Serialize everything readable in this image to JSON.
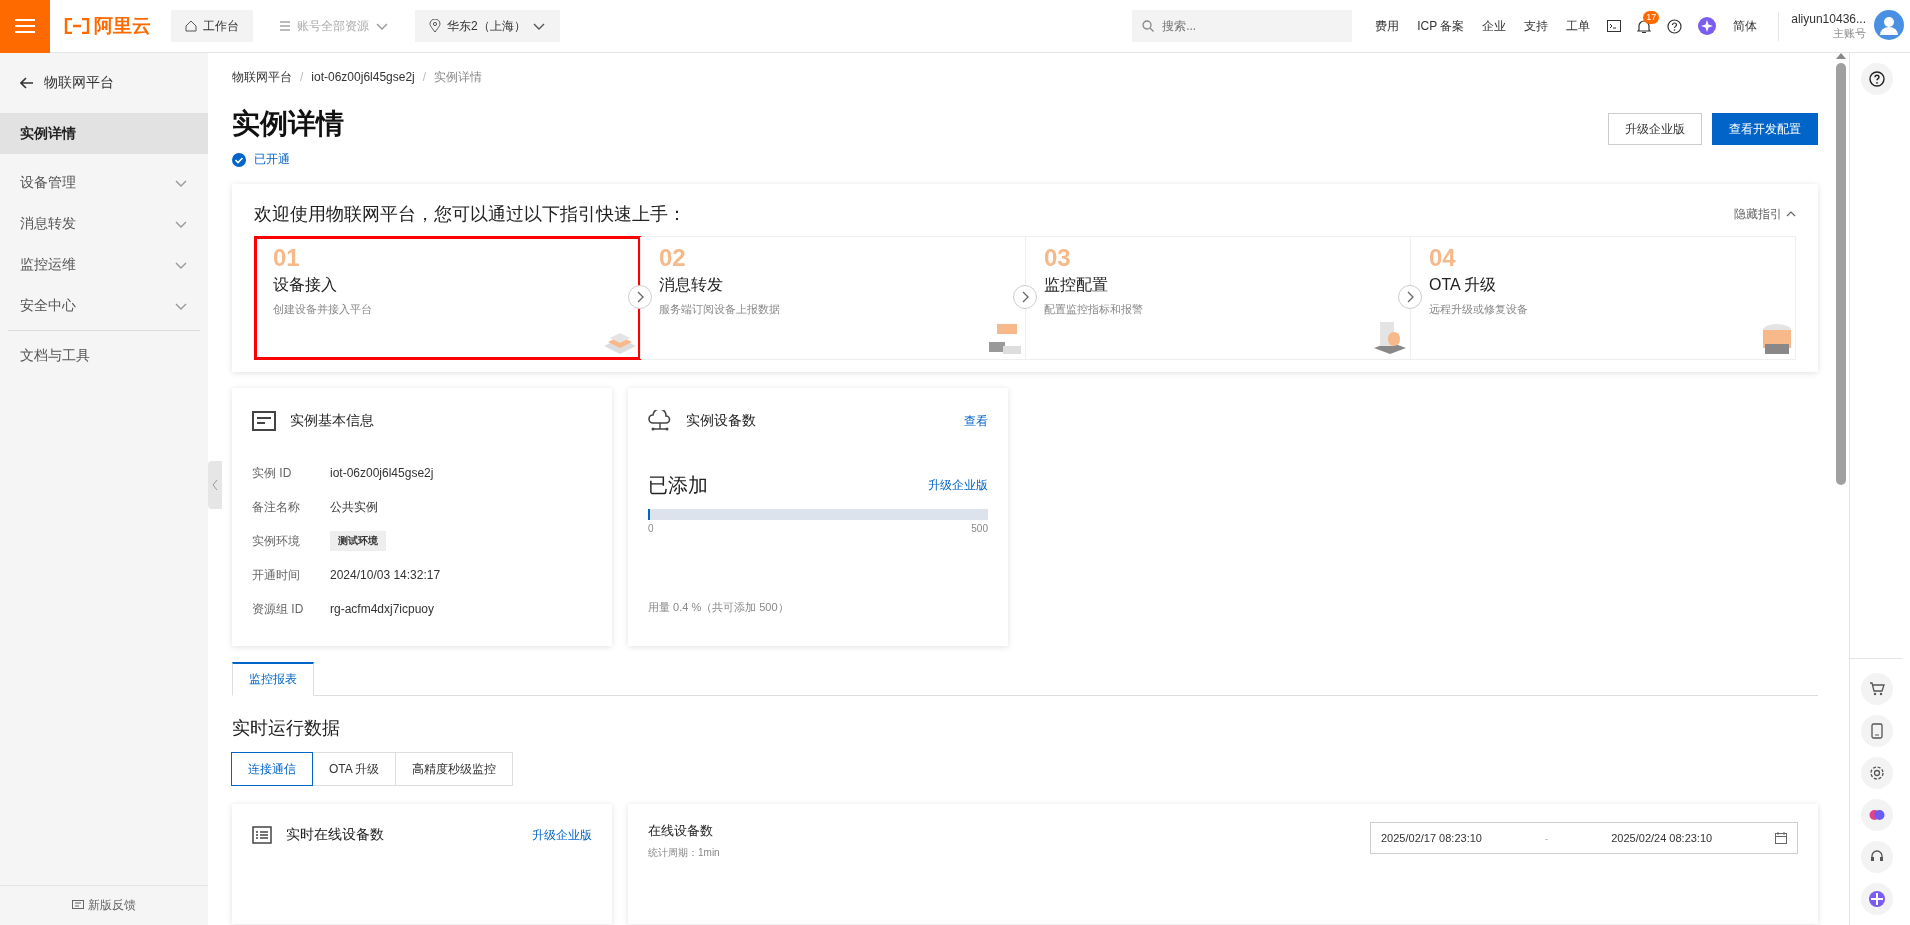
{
  "topbar": {
    "logo": "阿里云",
    "workbench": "工作台",
    "resources": {
      "label": "账号全部资源",
      "disabled": true
    },
    "region": "华东2（上海）",
    "search": {
      "placeholder": "搜索..."
    },
    "links": [
      "费用",
      "ICP 备案",
      "企业",
      "支持",
      "工单"
    ],
    "notifications": "17",
    "language": "简体",
    "account": {
      "name": "aliyun10436...",
      "role": "主账号"
    }
  },
  "sidebar": {
    "back": "物联网平台",
    "items": [
      {
        "label": "实例详情",
        "selected": true,
        "expandable": false
      },
      {
        "label": "设备管理",
        "selected": false,
        "expandable": true
      },
      {
        "label": "消息转发",
        "selected": false,
        "expandable": true
      },
      {
        "label": "监控运维",
        "selected": false,
        "expandable": true
      },
      {
        "label": "安全中心",
        "selected": false,
        "expandable": true
      },
      {
        "label": "文档与工具",
        "selected": false,
        "expandable": false
      }
    ],
    "feedback": "新版反馈"
  },
  "breadcrumb": {
    "separator": "/",
    "items": [
      "物联网平台",
      "iot-06z00j6l45gse2j",
      "实例详情"
    ]
  },
  "page": {
    "title": "实例详情",
    "status": "已开通",
    "buttons": [
      {
        "label": "升级企业版",
        "primary": false
      },
      {
        "label": "查看开发配置",
        "primary": true
      }
    ]
  },
  "guide": {
    "title": "欢迎使用物联网平台，您可以通过以下指引快速上手：",
    "hide": "隐藏指引",
    "steps": [
      {
        "number": "01",
        "title": "设备接入",
        "desc": "创建设备并接入平台",
        "highlighted": true
      },
      {
        "number": "02",
        "title": "消息转发",
        "desc": "服务端订阅设备上报数据",
        "highlighted": false
      },
      {
        "number": "03",
        "title": "监控配置",
        "desc": "配置监控指标和报警",
        "highlighted": false
      },
      {
        "number": "04",
        "title": "OTA 升级",
        "desc": "远程升级或修复设备",
        "highlighted": false
      }
    ]
  },
  "info": {
    "title": "实例基本信息",
    "rows": [
      {
        "label": "实例 ID",
        "value": "iot-06z00j6l45gse2j",
        "kind": "text"
      },
      {
        "label": "备注名称",
        "value": "公共实例",
        "kind": "text"
      },
      {
        "label": "实例环境",
        "value": "测试环境",
        "kind": "tag"
      },
      {
        "label": "开通时间",
        "value": "2024/10/03 14:32:17",
        "kind": "text"
      },
      {
        "label": "资源组 ID",
        "value": "rg-acfm4dxj7icpuoy",
        "kind": "text"
      }
    ]
  },
  "devices": {
    "title": "实例设备数",
    "link": "查看",
    "added": "已添加",
    "upgrade": "升级企业版",
    "level": 0.004,
    "min": "0",
    "max": "500",
    "usage": "用量 0.4 %（共可添加 500）"
  },
  "report_tabs": [
    {
      "label": "监控报表",
      "selected": true
    }
  ],
  "runtime": {
    "title": "实时运行数据",
    "tabs": [
      {
        "label": "连接通信",
        "selected": true
      },
      {
        "label": "OTA 升级",
        "selected": false
      },
      {
        "label": "高精度秒级监控",
        "selected": false
      }
    ]
  },
  "online_card": {
    "title": "实时在线设备数",
    "link": "升级企业版"
  },
  "online_chart": {
    "title": "在线设备数",
    "period": "统计周期：1min",
    "start": "2025/02/17 08:23:10",
    "separator": "-",
    "end": "2025/02/24 08:23:10"
  }
}
